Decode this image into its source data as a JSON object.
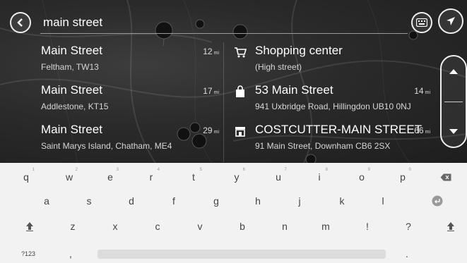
{
  "search": {
    "value": "main street"
  },
  "results_left": [
    {
      "name": "Main Street",
      "sub": "Feltham, TW13",
      "distance": "12",
      "unit": "mi"
    },
    {
      "name": "Main Street",
      "sub": "Addlestone, KT15",
      "distance": "17",
      "unit": "mi"
    },
    {
      "name": "Main Street",
      "sub": "Saint Marys Island, Chatham, ME4",
      "distance": "29",
      "unit": "mi"
    }
  ],
  "results_right": [
    {
      "name": "Shopping center",
      "sub": "(High street)",
      "distance": "",
      "unit": "",
      "icon": "shopping-cart-icon"
    },
    {
      "name": "53 Main Street",
      "sub": "941 Uxbridge Road, Hillingdon UB10 0NJ",
      "distance": "14",
      "unit": "mi",
      "icon": "shopping-bag-icon"
    },
    {
      "name": "COSTCUTTER-MAIN STREET",
      "sub": "91 Main Street, Downham CB6 2SX",
      "distance": "66",
      "unit": "mi",
      "icon": "store-icon"
    }
  ],
  "keyboard": {
    "row1": [
      {
        "k": "q",
        "n": "1"
      },
      {
        "k": "w",
        "n": "2"
      },
      {
        "k": "e",
        "n": "3"
      },
      {
        "k": "r",
        "n": "4"
      },
      {
        "k": "t",
        "n": "5"
      },
      {
        "k": "y",
        "n": "6"
      },
      {
        "k": "u",
        "n": "7"
      },
      {
        "k": "i",
        "n": "8"
      },
      {
        "k": "o",
        "n": "9"
      },
      {
        "k": "p",
        "n": "0"
      }
    ],
    "row2": [
      "a",
      "s",
      "d",
      "f",
      "g",
      "h",
      "j",
      "k",
      "l"
    ],
    "row3": [
      "z",
      "x",
      "c",
      "v",
      "b",
      "n",
      "m",
      "!",
      "?"
    ],
    "numbers_key": "?123",
    "comma_key": ",",
    "period_key": "."
  },
  "colors": {
    "accent": "#ffffff",
    "keyboard_bg": "#f2f2f2",
    "map_bg": "#2a2a2a"
  }
}
